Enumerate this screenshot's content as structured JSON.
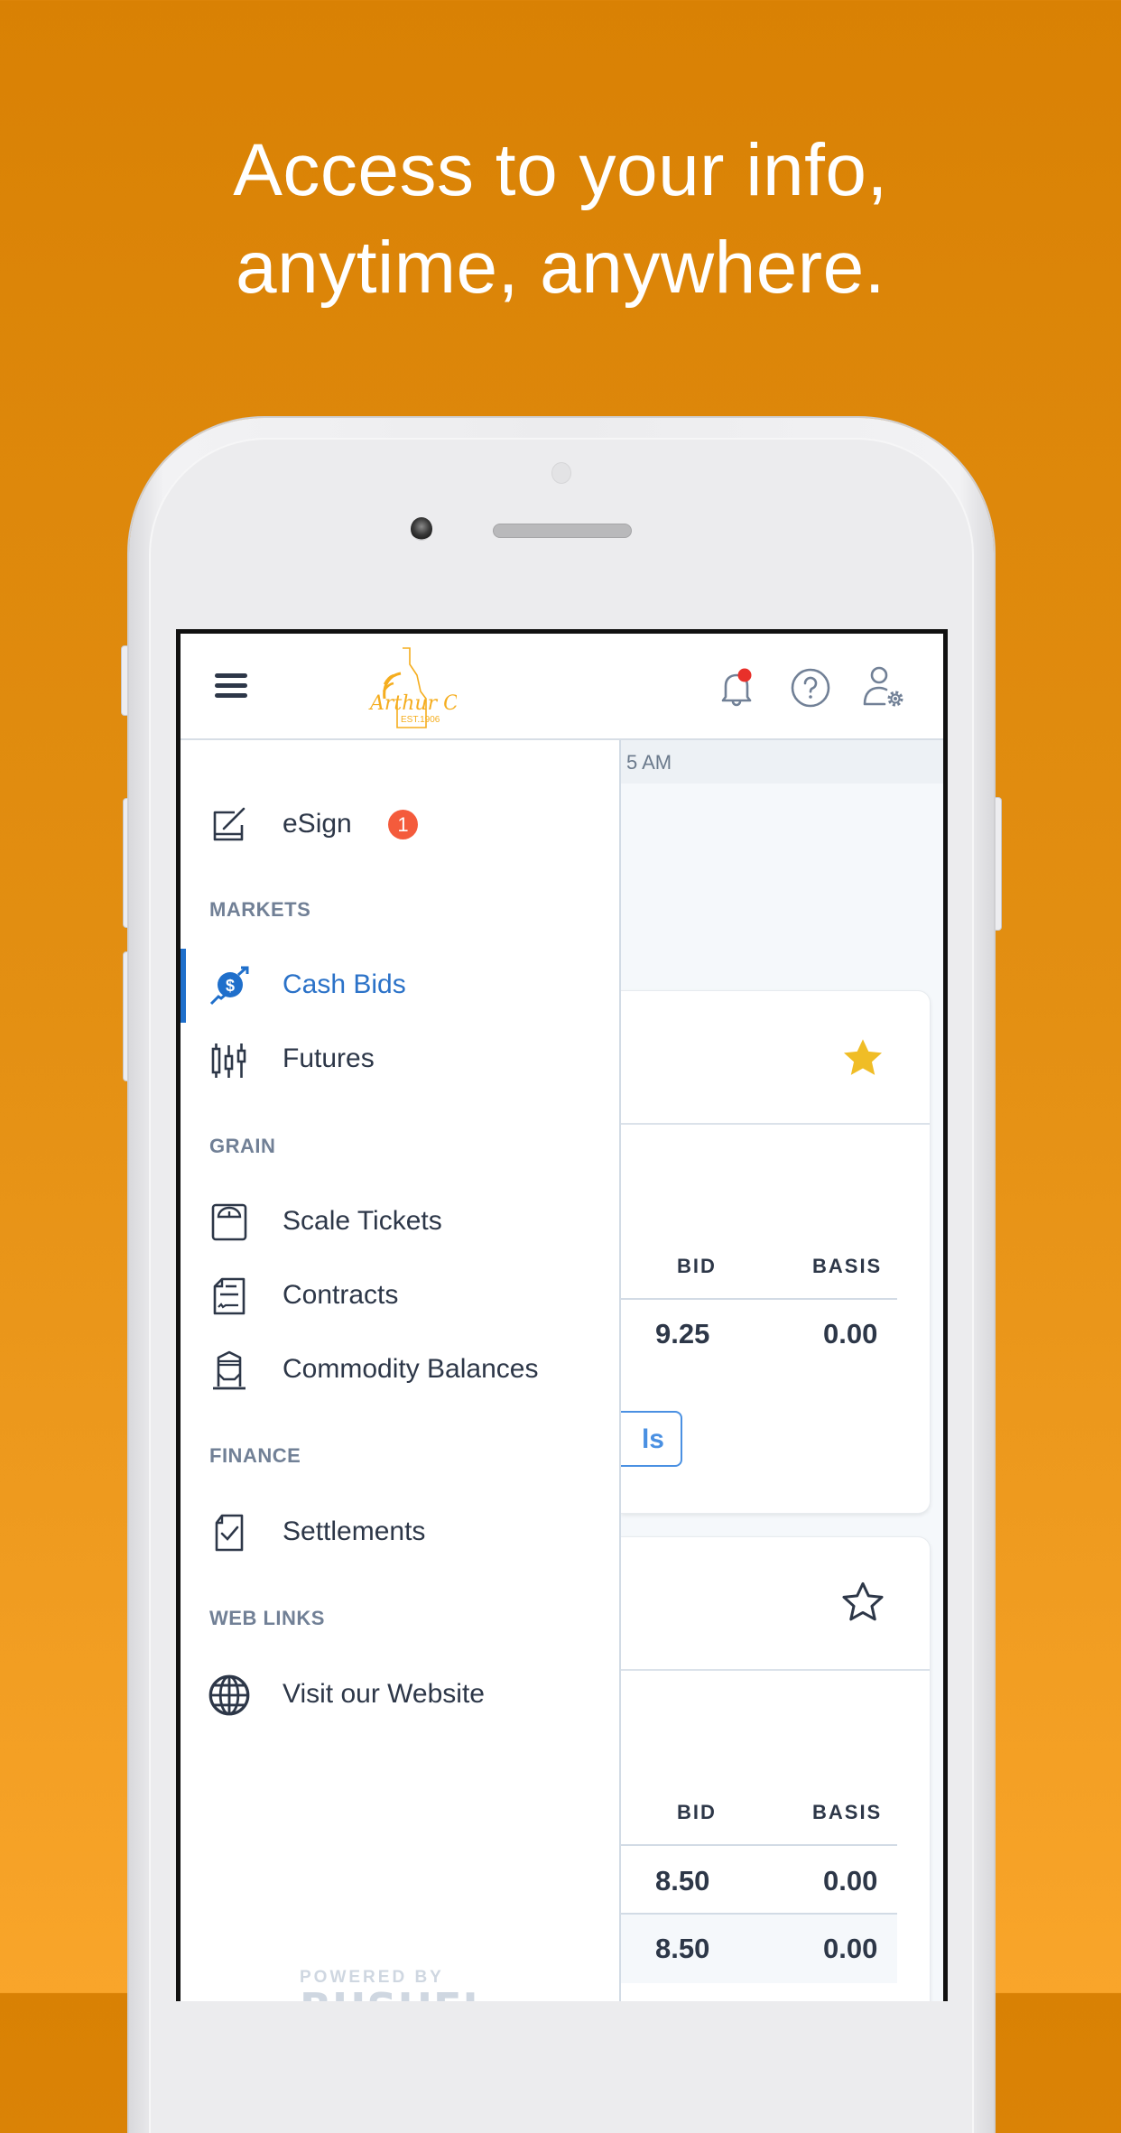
{
  "headline": {
    "line1": "Access to your info,",
    "line2": "anytime, anywhere."
  },
  "colors": {
    "background_top": "#d98104",
    "background_bottom": "#f9a52a",
    "accent_blue": "#1f6fcb",
    "badge_red": "#f45b3c",
    "star_gold": "#f0bd26",
    "brand_logo": "#f5ad1e"
  },
  "header": {
    "menu_icon": "hamburger-icon",
    "logo": {
      "name": "Arthur Co.",
      "tagline": "EST.1906"
    },
    "icons": [
      "bell-icon",
      "help-icon",
      "user-settings-icon"
    ],
    "notification_dot": true
  },
  "drawer": {
    "top_item": {
      "label": "eSign",
      "icon": "esign-icon",
      "badge": "1"
    },
    "sections": [
      {
        "title": "MARKETS",
        "items": [
          {
            "label": "Cash Bids",
            "icon": "cash-bids-icon",
            "active": true
          },
          {
            "label": "Futures",
            "icon": "futures-icon",
            "active": false
          }
        ]
      },
      {
        "title": "GRAIN",
        "items": [
          {
            "label": "Scale Tickets",
            "icon": "scale-icon"
          },
          {
            "label": "Contracts",
            "icon": "contract-icon"
          },
          {
            "label": "Commodity Balances",
            "icon": "silo-icon"
          }
        ]
      },
      {
        "title": "FINANCE",
        "items": [
          {
            "label": "Settlements",
            "icon": "settlement-icon"
          }
        ]
      },
      {
        "title": "WEB LINKS",
        "items": [
          {
            "label": "Visit our Website",
            "icon": "globe-icon"
          }
        ]
      }
    ],
    "footer": {
      "line1": "POWERED BY",
      "line2": "BUSHEL"
    }
  },
  "content": {
    "timestamp_partial": "5 AM",
    "cards": [
      {
        "favorited": true,
        "columns": [
          "BID",
          "BASIS"
        ],
        "rows": [
          {
            "bid": "9.25",
            "basis": "0.00"
          }
        ],
        "button_partial": "ls"
      },
      {
        "favorited": false,
        "columns": [
          "BID",
          "BASIS"
        ],
        "rows": [
          {
            "bid": "8.50",
            "basis": "0.00"
          },
          {
            "bid": "8.50",
            "basis": "0.00"
          }
        ]
      }
    ]
  }
}
